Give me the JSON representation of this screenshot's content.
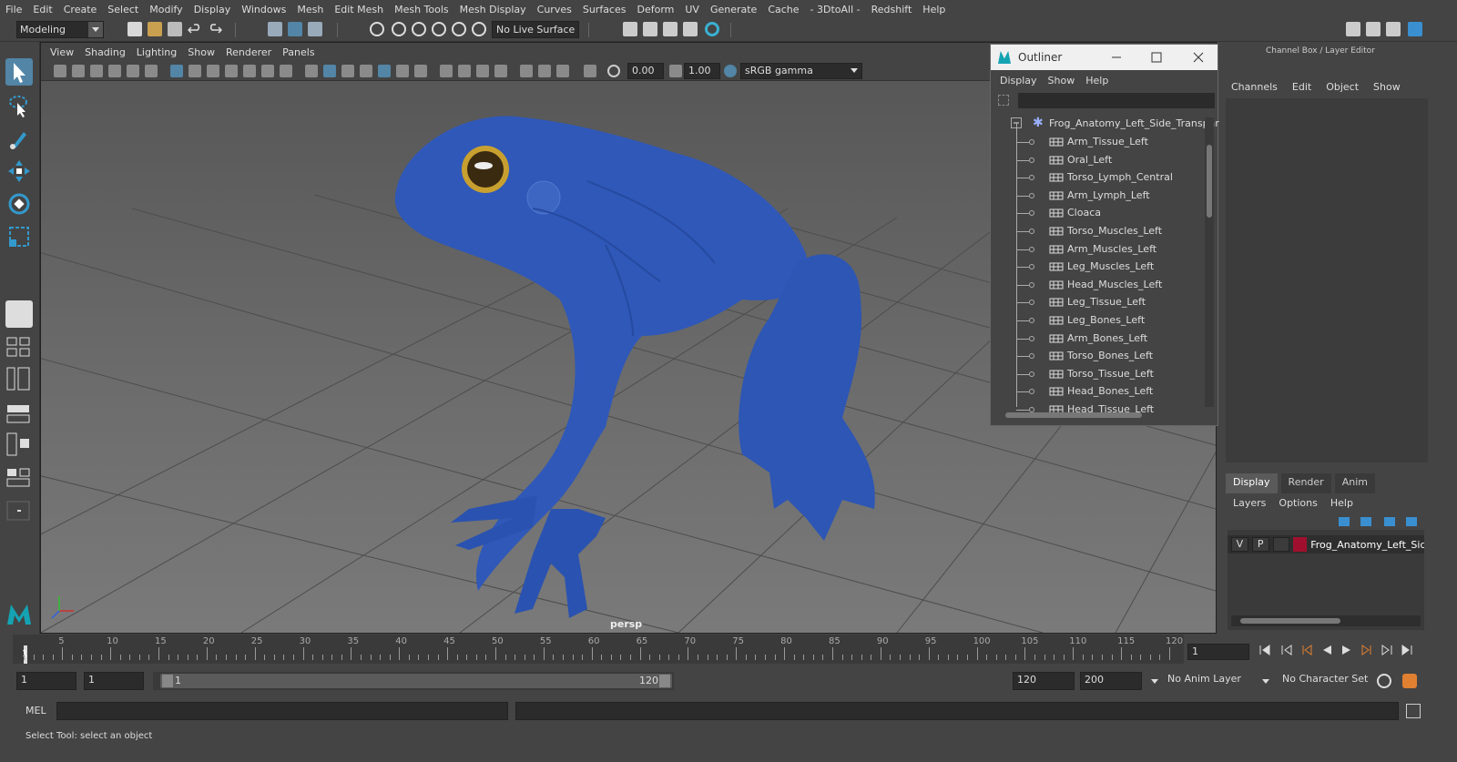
{
  "menubar": [
    "File",
    "Edit",
    "Create",
    "Select",
    "Modify",
    "Display",
    "Windows",
    "Mesh",
    "Edit Mesh",
    "Mesh Tools",
    "Mesh Display",
    "Curves",
    "Surfaces",
    "Deform",
    "UV",
    "Generate",
    "Cache",
    "- 3DtoAll -",
    "Redshift",
    "Help"
  ],
  "shelf": {
    "mode": "Modeling",
    "live_surface": "No Live Surface"
  },
  "viewport": {
    "menu": [
      "View",
      "Shading",
      "Lighting",
      "Show",
      "Renderer",
      "Panels"
    ],
    "exposure": "0.00",
    "gamma": "1.00",
    "color_space": "sRGB gamma",
    "camera_label": "persp"
  },
  "outliner": {
    "title": "Outliner",
    "menu": [
      "Display",
      "Show",
      "Help"
    ],
    "root": "Frog_Anatomy_Left_Side_Transpar",
    "items": [
      "Arm_Tissue_Left",
      "Oral_Left",
      "Torso_Lymph_Central",
      "Arm_Lymph_Left",
      "Cloaca",
      "Torso_Muscles_Left",
      "Arm_Muscles_Left",
      "Leg_Muscles_Left",
      "Head_Muscles_Left",
      "Leg_Tissue_Left",
      "Leg_Bones_Left",
      "Arm_Bones_Left",
      "Torso_Bones_Left",
      "Torso_Tissue_Left",
      "Head_Bones_Left",
      "Head_Tissue_Left"
    ]
  },
  "channelbox": {
    "title": "Channel Box / Layer Editor",
    "menu": [
      "Channels",
      "Edit",
      "Object",
      "Show"
    ],
    "tabs": [
      "Display",
      "Render",
      "Anim"
    ],
    "layer_menu": [
      "Layers",
      "Options",
      "Help"
    ],
    "layer": {
      "v": "V",
      "p": "P",
      "name": "Frog_Anatomy_Left_Side",
      "color": "#a0102e"
    }
  },
  "timeline": {
    "ticks": [
      "5",
      "10",
      "15",
      "20",
      "25",
      "30",
      "35",
      "40",
      "45",
      "50",
      "55",
      "60",
      "65",
      "70",
      "75",
      "80",
      "85",
      "90",
      "95",
      "100",
      "105",
      "110",
      "115",
      "120"
    ],
    "start_label": "1",
    "current_frame": "1"
  },
  "range": {
    "start": "1",
    "anim_start": "1",
    "bar_start": "1",
    "bar_end": "120",
    "end": "120",
    "anim_end": "200",
    "anim_layer": "No Anim Layer",
    "char_set": "No Character Set"
  },
  "cmdline": {
    "label": "MEL"
  },
  "status": "Select Tool: select an object"
}
